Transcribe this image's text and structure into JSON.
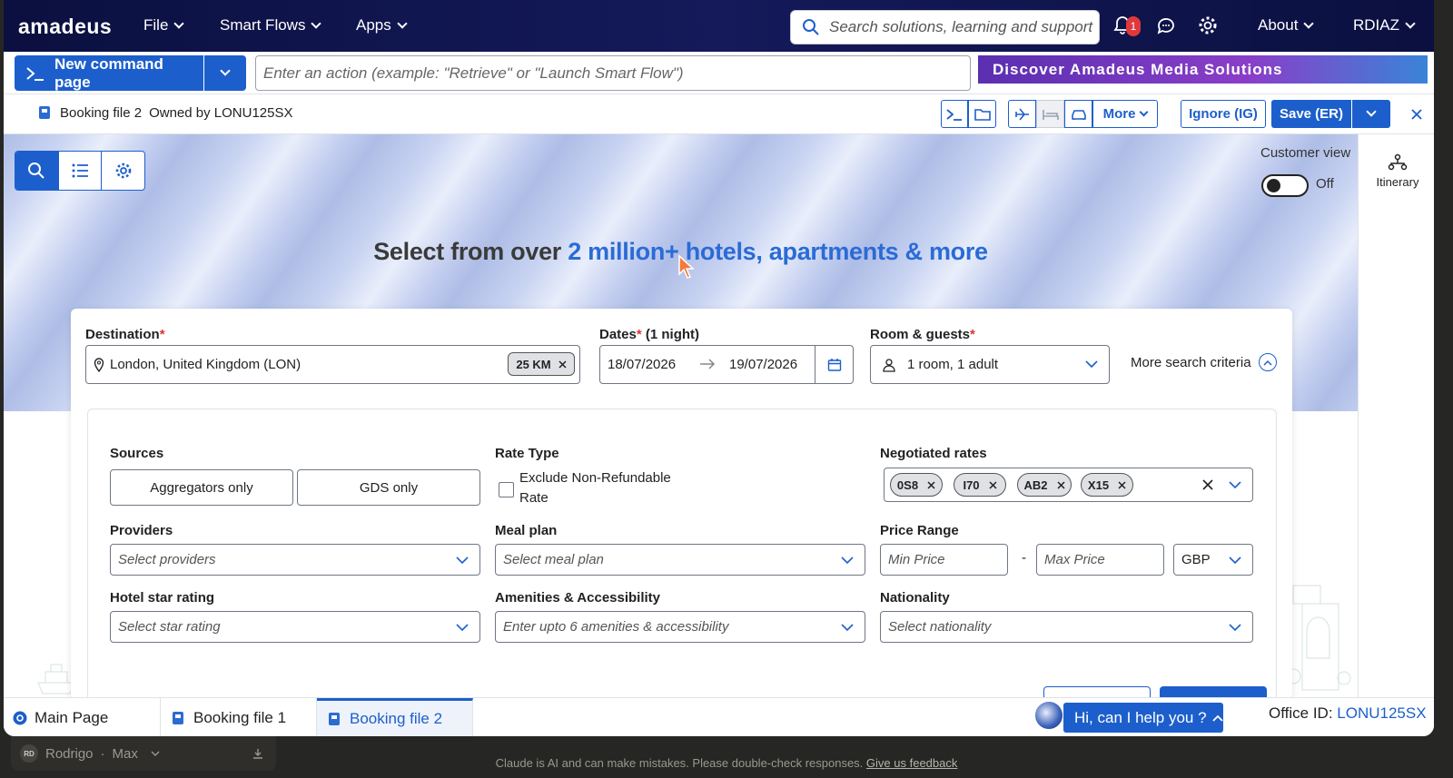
{
  "topnav": {
    "logo": "amadeus",
    "menu": [
      {
        "label": "File"
      },
      {
        "label": "Smart Flows"
      },
      {
        "label": "Apps"
      }
    ],
    "search_placeholder": "Search solutions, learning and support",
    "notification_count": "1",
    "about_label": "About",
    "user_label": "RDIAZ"
  },
  "cmdbar": {
    "new_command_label": "New command page",
    "command_placeholder": "Enter an action (example: \"Retrieve\" or \"Launch Smart Flow\")",
    "banner_text": "Discover Amadeus Media Solutions"
  },
  "booking": {
    "file_name": "Booking file 2",
    "owner": "Owned by LONU125SX",
    "more_label": "More",
    "ignore_label": "Ignore (IG)",
    "save_label": "Save (ER)"
  },
  "hero": {
    "title_prefix": "Select from over ",
    "title_highlight": "2 million+ hotels, apartments & more",
    "customer_view_label": "Customer view",
    "toggle_state": "Off",
    "itinerary_label": "Itinerary"
  },
  "search": {
    "destination_label": "Destination",
    "destination_value": "London, United Kingdom (LON)",
    "radius_chip": "25 KM",
    "dates_label": "Dates",
    "dates_nights": "(1 night)",
    "checkin": "18/07/2026",
    "checkout": "19/07/2026",
    "room_label": "Room & guests",
    "room_value": "1 room, 1 adult",
    "more_criteria_label": "More search criteria"
  },
  "filters": {
    "sources_label": "Sources",
    "sources_options": [
      "Aggregators only",
      "GDS only"
    ],
    "rate_type_label": "Rate Type",
    "exclude_nonrefundable_label": "Exclude Non-Refundable Rate",
    "negotiated_label": "Negotiated rates",
    "negotiated_chips": [
      "0S8",
      "I70",
      "AB2",
      "X15"
    ],
    "providers_label": "Providers",
    "providers_placeholder": "Select providers",
    "meal_label": "Meal plan",
    "meal_placeholder": "Select meal plan",
    "price_label": "Price Range",
    "min_price_placeholder": "Min Price",
    "max_price_placeholder": "Max Price",
    "currency": "GBP",
    "star_label": "Hotel star rating",
    "star_placeholder": "Select star rating",
    "amenities_label": "Amenities & Accessibility",
    "amenities_placeholder": "Enter upto 6 amenities & accessibility",
    "nationality_label": "Nationality",
    "nationality_placeholder": "Select nationality",
    "price_separator": "-"
  },
  "tabs": [
    {
      "label": "Main Page"
    },
    {
      "label": "Booking file 1"
    },
    {
      "label": "Booking file 2"
    }
  ],
  "chat": {
    "label": "Hi, can I help you ?"
  },
  "office": {
    "prefix": "Office ID: ",
    "id": "LONU125SX"
  },
  "claude": {
    "user_initials": "RD",
    "user_name": "Rodrigo",
    "plan": "Max",
    "disclaimer": "Claude is AI and can make mistakes. Please double-check responses.",
    "feedback_link": "Give us feedback"
  },
  "colors": {
    "accent": "#1c5fcc",
    "nav_bg": "#0b1040",
    "highlight": "#2a6bd6"
  }
}
